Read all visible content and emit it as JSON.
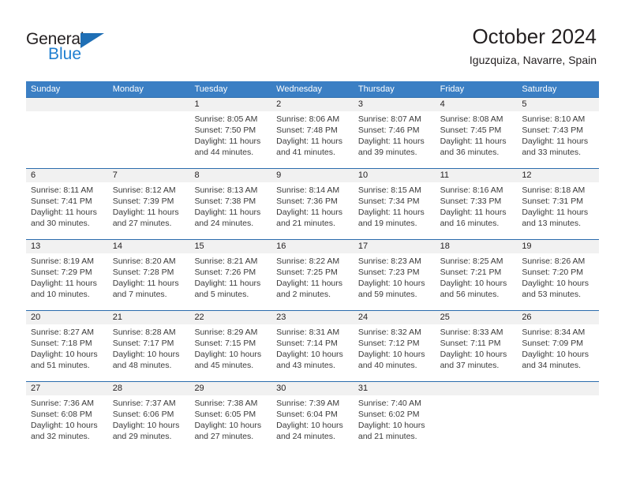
{
  "brand": {
    "name_part1": "General",
    "name_part2": "Blue",
    "triangle_icon": "triangle-icon",
    "color_dark": "#231f20",
    "color_blue": "#1f7fd0"
  },
  "header": {
    "title": "October 2024",
    "subtitle": "Iguzquiza, Navarre, Spain"
  },
  "theme": {
    "header_bg": "#3b7fc4",
    "week_divider": "#2b6cad",
    "daynum_bg": "#f1f1f1",
    "text": "#231f20"
  },
  "weekdays": [
    "Sunday",
    "Monday",
    "Tuesday",
    "Wednesday",
    "Thursday",
    "Friday",
    "Saturday"
  ],
  "weeks": [
    [
      {
        "day": "",
        "sunrise": "",
        "sunset": "",
        "daylight1": "",
        "daylight2": ""
      },
      {
        "day": "",
        "sunrise": "",
        "sunset": "",
        "daylight1": "",
        "daylight2": ""
      },
      {
        "day": "1",
        "sunrise": "Sunrise: 8:05 AM",
        "sunset": "Sunset: 7:50 PM",
        "daylight1": "Daylight: 11 hours",
        "daylight2": "and 44 minutes."
      },
      {
        "day": "2",
        "sunrise": "Sunrise: 8:06 AM",
        "sunset": "Sunset: 7:48 PM",
        "daylight1": "Daylight: 11 hours",
        "daylight2": "and 41 minutes."
      },
      {
        "day": "3",
        "sunrise": "Sunrise: 8:07 AM",
        "sunset": "Sunset: 7:46 PM",
        "daylight1": "Daylight: 11 hours",
        "daylight2": "and 39 minutes."
      },
      {
        "day": "4",
        "sunrise": "Sunrise: 8:08 AM",
        "sunset": "Sunset: 7:45 PM",
        "daylight1": "Daylight: 11 hours",
        "daylight2": "and 36 minutes."
      },
      {
        "day": "5",
        "sunrise": "Sunrise: 8:10 AM",
        "sunset": "Sunset: 7:43 PM",
        "daylight1": "Daylight: 11 hours",
        "daylight2": "and 33 minutes."
      }
    ],
    [
      {
        "day": "6",
        "sunrise": "Sunrise: 8:11 AM",
        "sunset": "Sunset: 7:41 PM",
        "daylight1": "Daylight: 11 hours",
        "daylight2": "and 30 minutes."
      },
      {
        "day": "7",
        "sunrise": "Sunrise: 8:12 AM",
        "sunset": "Sunset: 7:39 PM",
        "daylight1": "Daylight: 11 hours",
        "daylight2": "and 27 minutes."
      },
      {
        "day": "8",
        "sunrise": "Sunrise: 8:13 AM",
        "sunset": "Sunset: 7:38 PM",
        "daylight1": "Daylight: 11 hours",
        "daylight2": "and 24 minutes."
      },
      {
        "day": "9",
        "sunrise": "Sunrise: 8:14 AM",
        "sunset": "Sunset: 7:36 PM",
        "daylight1": "Daylight: 11 hours",
        "daylight2": "and 21 minutes."
      },
      {
        "day": "10",
        "sunrise": "Sunrise: 8:15 AM",
        "sunset": "Sunset: 7:34 PM",
        "daylight1": "Daylight: 11 hours",
        "daylight2": "and 19 minutes."
      },
      {
        "day": "11",
        "sunrise": "Sunrise: 8:16 AM",
        "sunset": "Sunset: 7:33 PM",
        "daylight1": "Daylight: 11 hours",
        "daylight2": "and 16 minutes."
      },
      {
        "day": "12",
        "sunrise": "Sunrise: 8:18 AM",
        "sunset": "Sunset: 7:31 PM",
        "daylight1": "Daylight: 11 hours",
        "daylight2": "and 13 minutes."
      }
    ],
    [
      {
        "day": "13",
        "sunrise": "Sunrise: 8:19 AM",
        "sunset": "Sunset: 7:29 PM",
        "daylight1": "Daylight: 11 hours",
        "daylight2": "and 10 minutes."
      },
      {
        "day": "14",
        "sunrise": "Sunrise: 8:20 AM",
        "sunset": "Sunset: 7:28 PM",
        "daylight1": "Daylight: 11 hours",
        "daylight2": "and 7 minutes."
      },
      {
        "day": "15",
        "sunrise": "Sunrise: 8:21 AM",
        "sunset": "Sunset: 7:26 PM",
        "daylight1": "Daylight: 11 hours",
        "daylight2": "and 5 minutes."
      },
      {
        "day": "16",
        "sunrise": "Sunrise: 8:22 AM",
        "sunset": "Sunset: 7:25 PM",
        "daylight1": "Daylight: 11 hours",
        "daylight2": "and 2 minutes."
      },
      {
        "day": "17",
        "sunrise": "Sunrise: 8:23 AM",
        "sunset": "Sunset: 7:23 PM",
        "daylight1": "Daylight: 10 hours",
        "daylight2": "and 59 minutes."
      },
      {
        "day": "18",
        "sunrise": "Sunrise: 8:25 AM",
        "sunset": "Sunset: 7:21 PM",
        "daylight1": "Daylight: 10 hours",
        "daylight2": "and 56 minutes."
      },
      {
        "day": "19",
        "sunrise": "Sunrise: 8:26 AM",
        "sunset": "Sunset: 7:20 PM",
        "daylight1": "Daylight: 10 hours",
        "daylight2": "and 53 minutes."
      }
    ],
    [
      {
        "day": "20",
        "sunrise": "Sunrise: 8:27 AM",
        "sunset": "Sunset: 7:18 PM",
        "daylight1": "Daylight: 10 hours",
        "daylight2": "and 51 minutes."
      },
      {
        "day": "21",
        "sunrise": "Sunrise: 8:28 AM",
        "sunset": "Sunset: 7:17 PM",
        "daylight1": "Daylight: 10 hours",
        "daylight2": "and 48 minutes."
      },
      {
        "day": "22",
        "sunrise": "Sunrise: 8:29 AM",
        "sunset": "Sunset: 7:15 PM",
        "daylight1": "Daylight: 10 hours",
        "daylight2": "and 45 minutes."
      },
      {
        "day": "23",
        "sunrise": "Sunrise: 8:31 AM",
        "sunset": "Sunset: 7:14 PM",
        "daylight1": "Daylight: 10 hours",
        "daylight2": "and 43 minutes."
      },
      {
        "day": "24",
        "sunrise": "Sunrise: 8:32 AM",
        "sunset": "Sunset: 7:12 PM",
        "daylight1": "Daylight: 10 hours",
        "daylight2": "and 40 minutes."
      },
      {
        "day": "25",
        "sunrise": "Sunrise: 8:33 AM",
        "sunset": "Sunset: 7:11 PM",
        "daylight1": "Daylight: 10 hours",
        "daylight2": "and 37 minutes."
      },
      {
        "day": "26",
        "sunrise": "Sunrise: 8:34 AM",
        "sunset": "Sunset: 7:09 PM",
        "daylight1": "Daylight: 10 hours",
        "daylight2": "and 34 minutes."
      }
    ],
    [
      {
        "day": "27",
        "sunrise": "Sunrise: 7:36 AM",
        "sunset": "Sunset: 6:08 PM",
        "daylight1": "Daylight: 10 hours",
        "daylight2": "and 32 minutes."
      },
      {
        "day": "28",
        "sunrise": "Sunrise: 7:37 AM",
        "sunset": "Sunset: 6:06 PM",
        "daylight1": "Daylight: 10 hours",
        "daylight2": "and 29 minutes."
      },
      {
        "day": "29",
        "sunrise": "Sunrise: 7:38 AM",
        "sunset": "Sunset: 6:05 PM",
        "daylight1": "Daylight: 10 hours",
        "daylight2": "and 27 minutes."
      },
      {
        "day": "30",
        "sunrise": "Sunrise: 7:39 AM",
        "sunset": "Sunset: 6:04 PM",
        "daylight1": "Daylight: 10 hours",
        "daylight2": "and 24 minutes."
      },
      {
        "day": "31",
        "sunrise": "Sunrise: 7:40 AM",
        "sunset": "Sunset: 6:02 PM",
        "daylight1": "Daylight: 10 hours",
        "daylight2": "and 21 minutes."
      },
      {
        "day": "",
        "sunrise": "",
        "sunset": "",
        "daylight1": "",
        "daylight2": ""
      },
      {
        "day": "",
        "sunrise": "",
        "sunset": "",
        "daylight1": "",
        "daylight2": ""
      }
    ]
  ]
}
